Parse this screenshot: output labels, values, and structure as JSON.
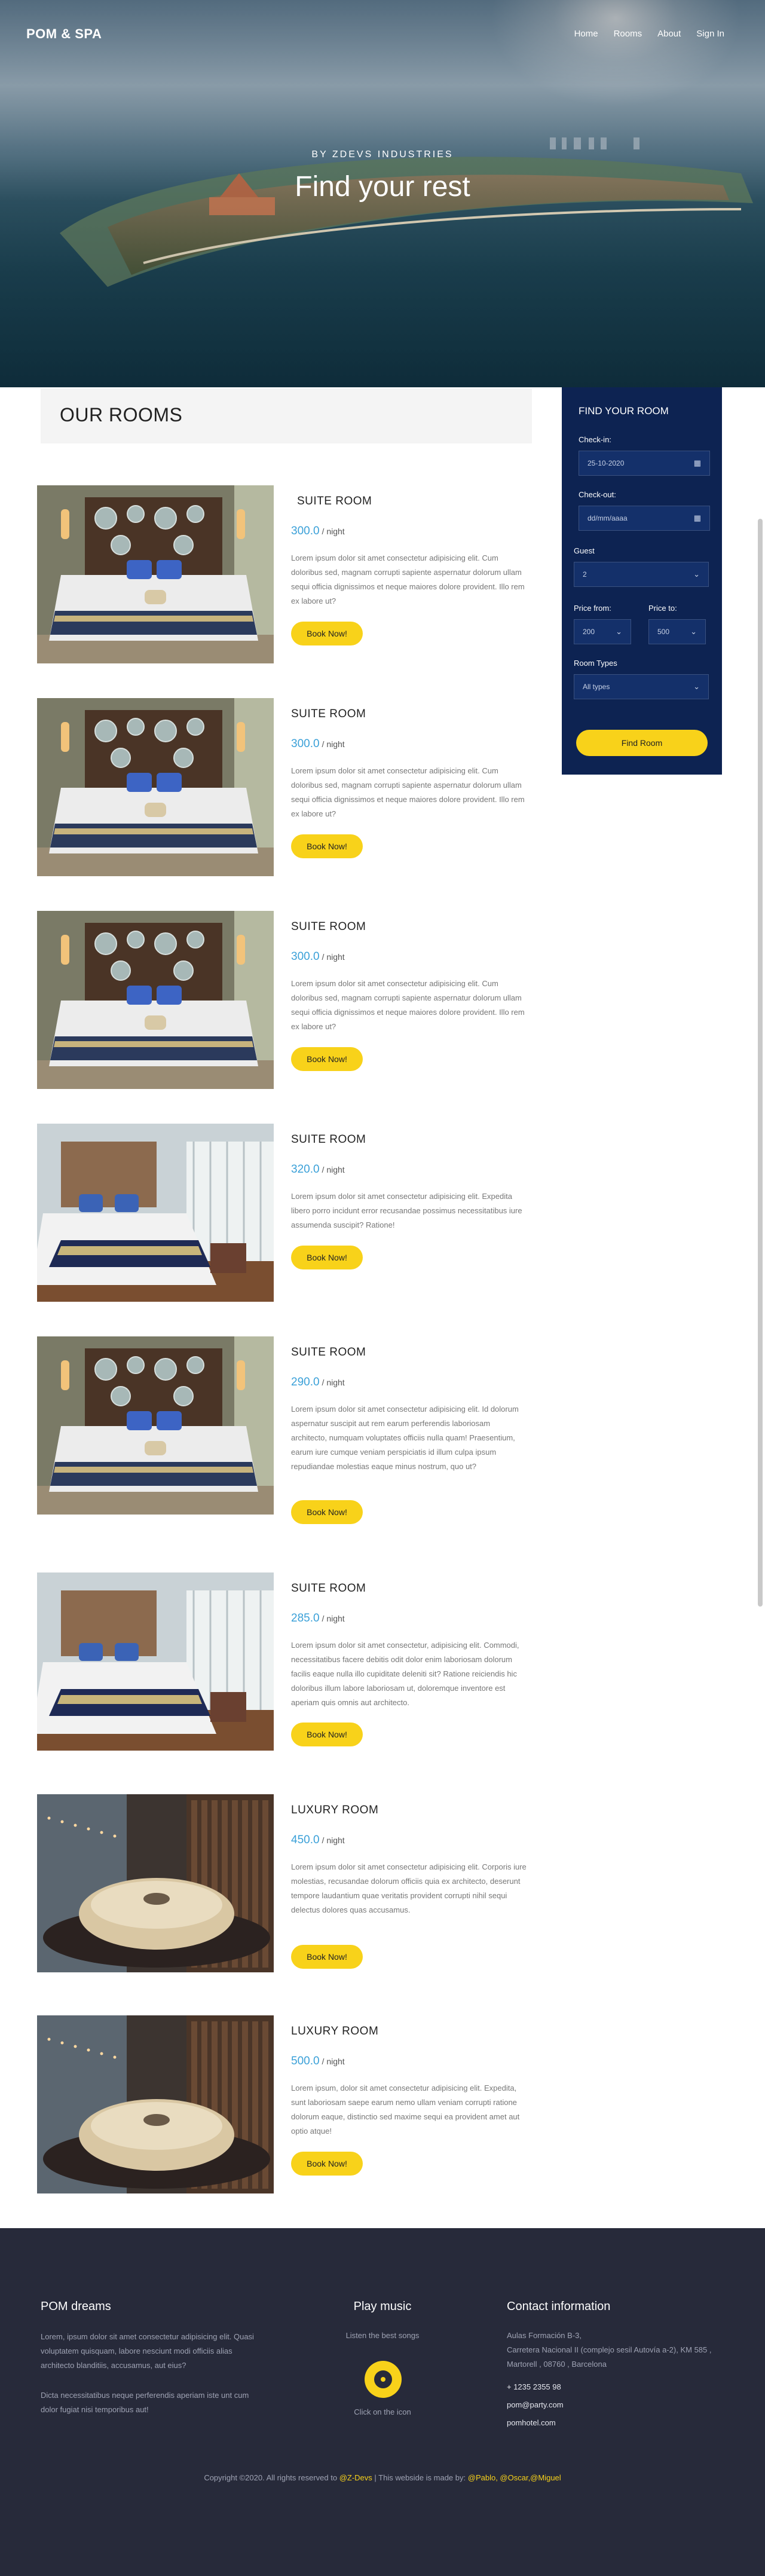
{
  "header": {
    "brand": "POM & SPA",
    "nav": [
      "Home",
      "Rooms",
      "About",
      "Sign In"
    ],
    "subtitle": "BY ZDEVS INDUSTRIES",
    "title": "Find your rest"
  },
  "rooms_section": {
    "title": "OUR ROOMS"
  },
  "finder": {
    "title": "FIND YOUR ROOM",
    "checkin_label": "Check-in:",
    "checkin_value": "25-10-2020",
    "checkout_label": "Check-out:",
    "checkout_value": "dd/mm/aaaa",
    "guest_label": "Guest",
    "guest_value": "2",
    "price_from_label": "Price from:",
    "price_from_value": "200",
    "price_to_label": "Price to:",
    "price_to_value": "500",
    "room_types_label": "Room Types",
    "room_types_value": "All types",
    "button": "Find Room"
  },
  "rooms": [
    {
      "title": "SUITE ROOM",
      "price": "300.0",
      "per": "/ night",
      "desc": "Lorem ipsum dolor sit amet consectetur adipisicing elit. Cum doloribus sed, magnam corrupti sapiente aspernatur dolorum ullam sequi officia dignissimos et neque maiores dolore provident. Illo rem ex labore ut?",
      "button": "Book Now!"
    },
    {
      "title": "SUITE ROOM",
      "price": "300.0",
      "per": "/ night",
      "desc": "Lorem ipsum dolor sit amet consectetur adipisicing elit. Cum doloribus sed, magnam corrupti sapiente aspernatur dolorum ullam sequi officia dignissimos et neque maiores dolore provident. Illo rem ex labore ut?",
      "button": "Book Now!"
    },
    {
      "title": "SUITE ROOM",
      "price": "300.0",
      "per": "/ night",
      "desc": "Lorem ipsum dolor sit amet consectetur adipisicing elit. Cum doloribus sed, magnam corrupti sapiente aspernatur dolorum ullam sequi officia dignissimos et neque maiores dolore provident. Illo rem ex labore ut?",
      "button": "Book Now!"
    },
    {
      "title": "SUITE ROOM",
      "price": "320.0",
      "per": "/ night",
      "desc": "Lorem ipsum dolor sit amet consectetur adipisicing elit. Expedita libero porro incidunt error recusandae possimus necessitatibus iure assumenda suscipit? Ratione!",
      "button": "Book Now!"
    },
    {
      "title": "SUITE ROOM",
      "price": "290.0",
      "per": "/ night",
      "desc": "Lorem ipsum dolor sit amet consectetur adipisicing elit. Id dolorum aspernatur suscipit aut rem earum perferendis laboriosam architecto, numquam voluptates officiis nulla quam! Praesentium, earum iure cumque veniam perspiciatis id illum culpa ipsum repudiandae molestias eaque minus nostrum, quo ut?",
      "button": "Book Now!"
    },
    {
      "title": "SUITE ROOM",
      "price": "285.0",
      "per": "/ night",
      "desc": "Lorem ipsum dolor sit amet consectetur, adipisicing elit. Commodi, necessitatibus facere debitis odit dolor enim laboriosam dolorum facilis eaque nulla illo cupiditate deleniti sit? Ratione reiciendis hic doloribus illum labore laboriosam ut, doloremque inventore est aperiam quis omnis aut architecto.",
      "button": "Book Now!"
    },
    {
      "title": "LUXURY ROOM",
      "price": "450.0",
      "per": "/ night",
      "desc": "Lorem ipsum dolor sit amet consectetur adipisicing elit. Corporis iure molestias, recusandae dolorum officiis quia ex architecto, deserunt tempore laudantium quae veritatis provident corrupti nihil sequi delectus dolores quas accusamus.",
      "button": "Book Now!"
    },
    {
      "title": "LUXURY ROOM",
      "price": "500.0",
      "per": "/ night",
      "desc": "Lorem ipsum, dolor sit amet consectetur adipisicing elit. Expedita, sunt laboriosam saepe earum nemo ullam veniam corrupti ratione dolorum eaque, distinctio sed maxime sequi ea provident amet aut optio atque!",
      "button": "Book Now!"
    }
  ],
  "footer": {
    "col1_title": "POM dreams",
    "col1_p1": "Lorem, ipsum dolor sit amet consectetur adipisicing elit. Quasi voluptatem quisquam, labore nesciunt modi officiis alias architecto blanditiis, accusamus, aut eius?",
    "col1_p2": "Dicta necessitatibus neque perferendis aperiam iste unt cum dolor fugiat nisi temporibus aut!",
    "col2_title": "Play music",
    "col2_top": "Listen the best songs",
    "col2_bottom": "Click on the icon",
    "col3_title": "Contact information",
    "col3_addr1": "Aulas Formación B-3,",
    "col3_addr2": "Carretera Nacional II (complejo sesil Autovía a-2), KM 585 , Martorell , 08760 , Barcelona",
    "col3_phone": "+ 1235 2355 98",
    "col3_email": "pom@party.com",
    "col3_web": "pomhotel.com",
    "copy_pre": "Copyright ©2020. All rights reserved to",
    "copy_brand": "@Z-Devs",
    "copy_mid": "| This webside is made by:",
    "copy_authors": "@Pablo, @Oscar,@Miguel"
  },
  "colors": {
    "accent": "#f8d21a",
    "price": "#3aa0d8",
    "panel": "#0d2352",
    "footer": "#272a3a"
  }
}
